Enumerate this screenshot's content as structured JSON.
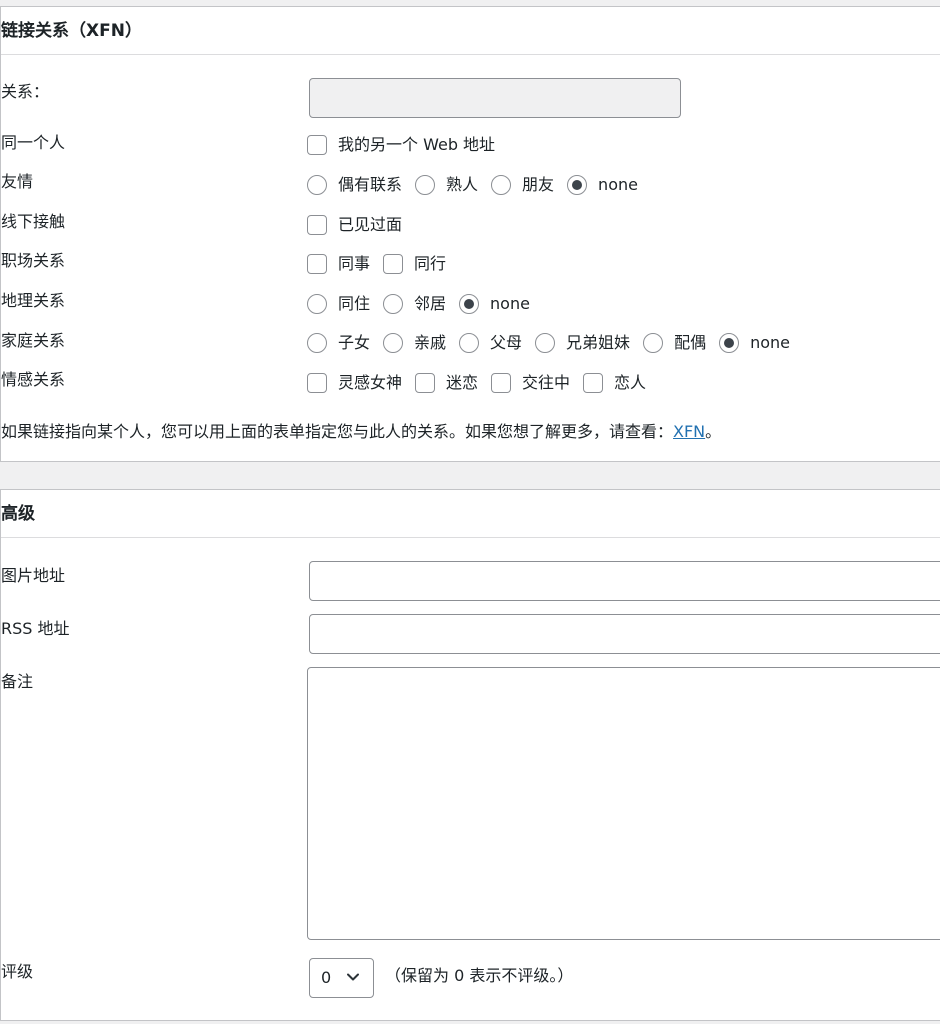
{
  "xfn": {
    "title": "链接关系（XFN）",
    "rel_label": "关系：",
    "rel_value": "",
    "rows": {
      "me": {
        "label": "同一个人",
        "options": [
          "我的另一个 Web 地址"
        ]
      },
      "friendship": {
        "label": "友情",
        "options": [
          "偶有联系",
          "熟人",
          "朋友",
          "none"
        ],
        "selected": "none"
      },
      "physical": {
        "label": "线下接触",
        "options": [
          "已见过面"
        ]
      },
      "professional": {
        "label": "职场关系",
        "options": [
          "同事",
          "同行"
        ]
      },
      "geographical": {
        "label": "地理关系",
        "options": [
          "同住",
          "邻居",
          "none"
        ],
        "selected": "none"
      },
      "family": {
        "label": "家庭关系",
        "options": [
          "子女",
          "亲戚",
          "父母",
          "兄弟姐妹",
          "配偶",
          "none"
        ],
        "selected": "none"
      },
      "romantic": {
        "label": "情感关系",
        "options": [
          "灵感女神",
          "迷恋",
          "交往中",
          "恋人"
        ]
      }
    },
    "help_text": "如果链接指向某个人，您可以用上面的表单指定您与此人的关系。如果您想了解更多，请查看：",
    "help_link": "XFN",
    "help_end": "。"
  },
  "advanced": {
    "title": "高级",
    "image_label": "图片地址",
    "image_value": "",
    "rss_label": "RSS 地址",
    "rss_value": "",
    "notes_label": "备注",
    "notes_value": "",
    "rating_label": "评级",
    "rating_value": "0",
    "rating_note": "（保留为 0 表示不评级。）"
  }
}
